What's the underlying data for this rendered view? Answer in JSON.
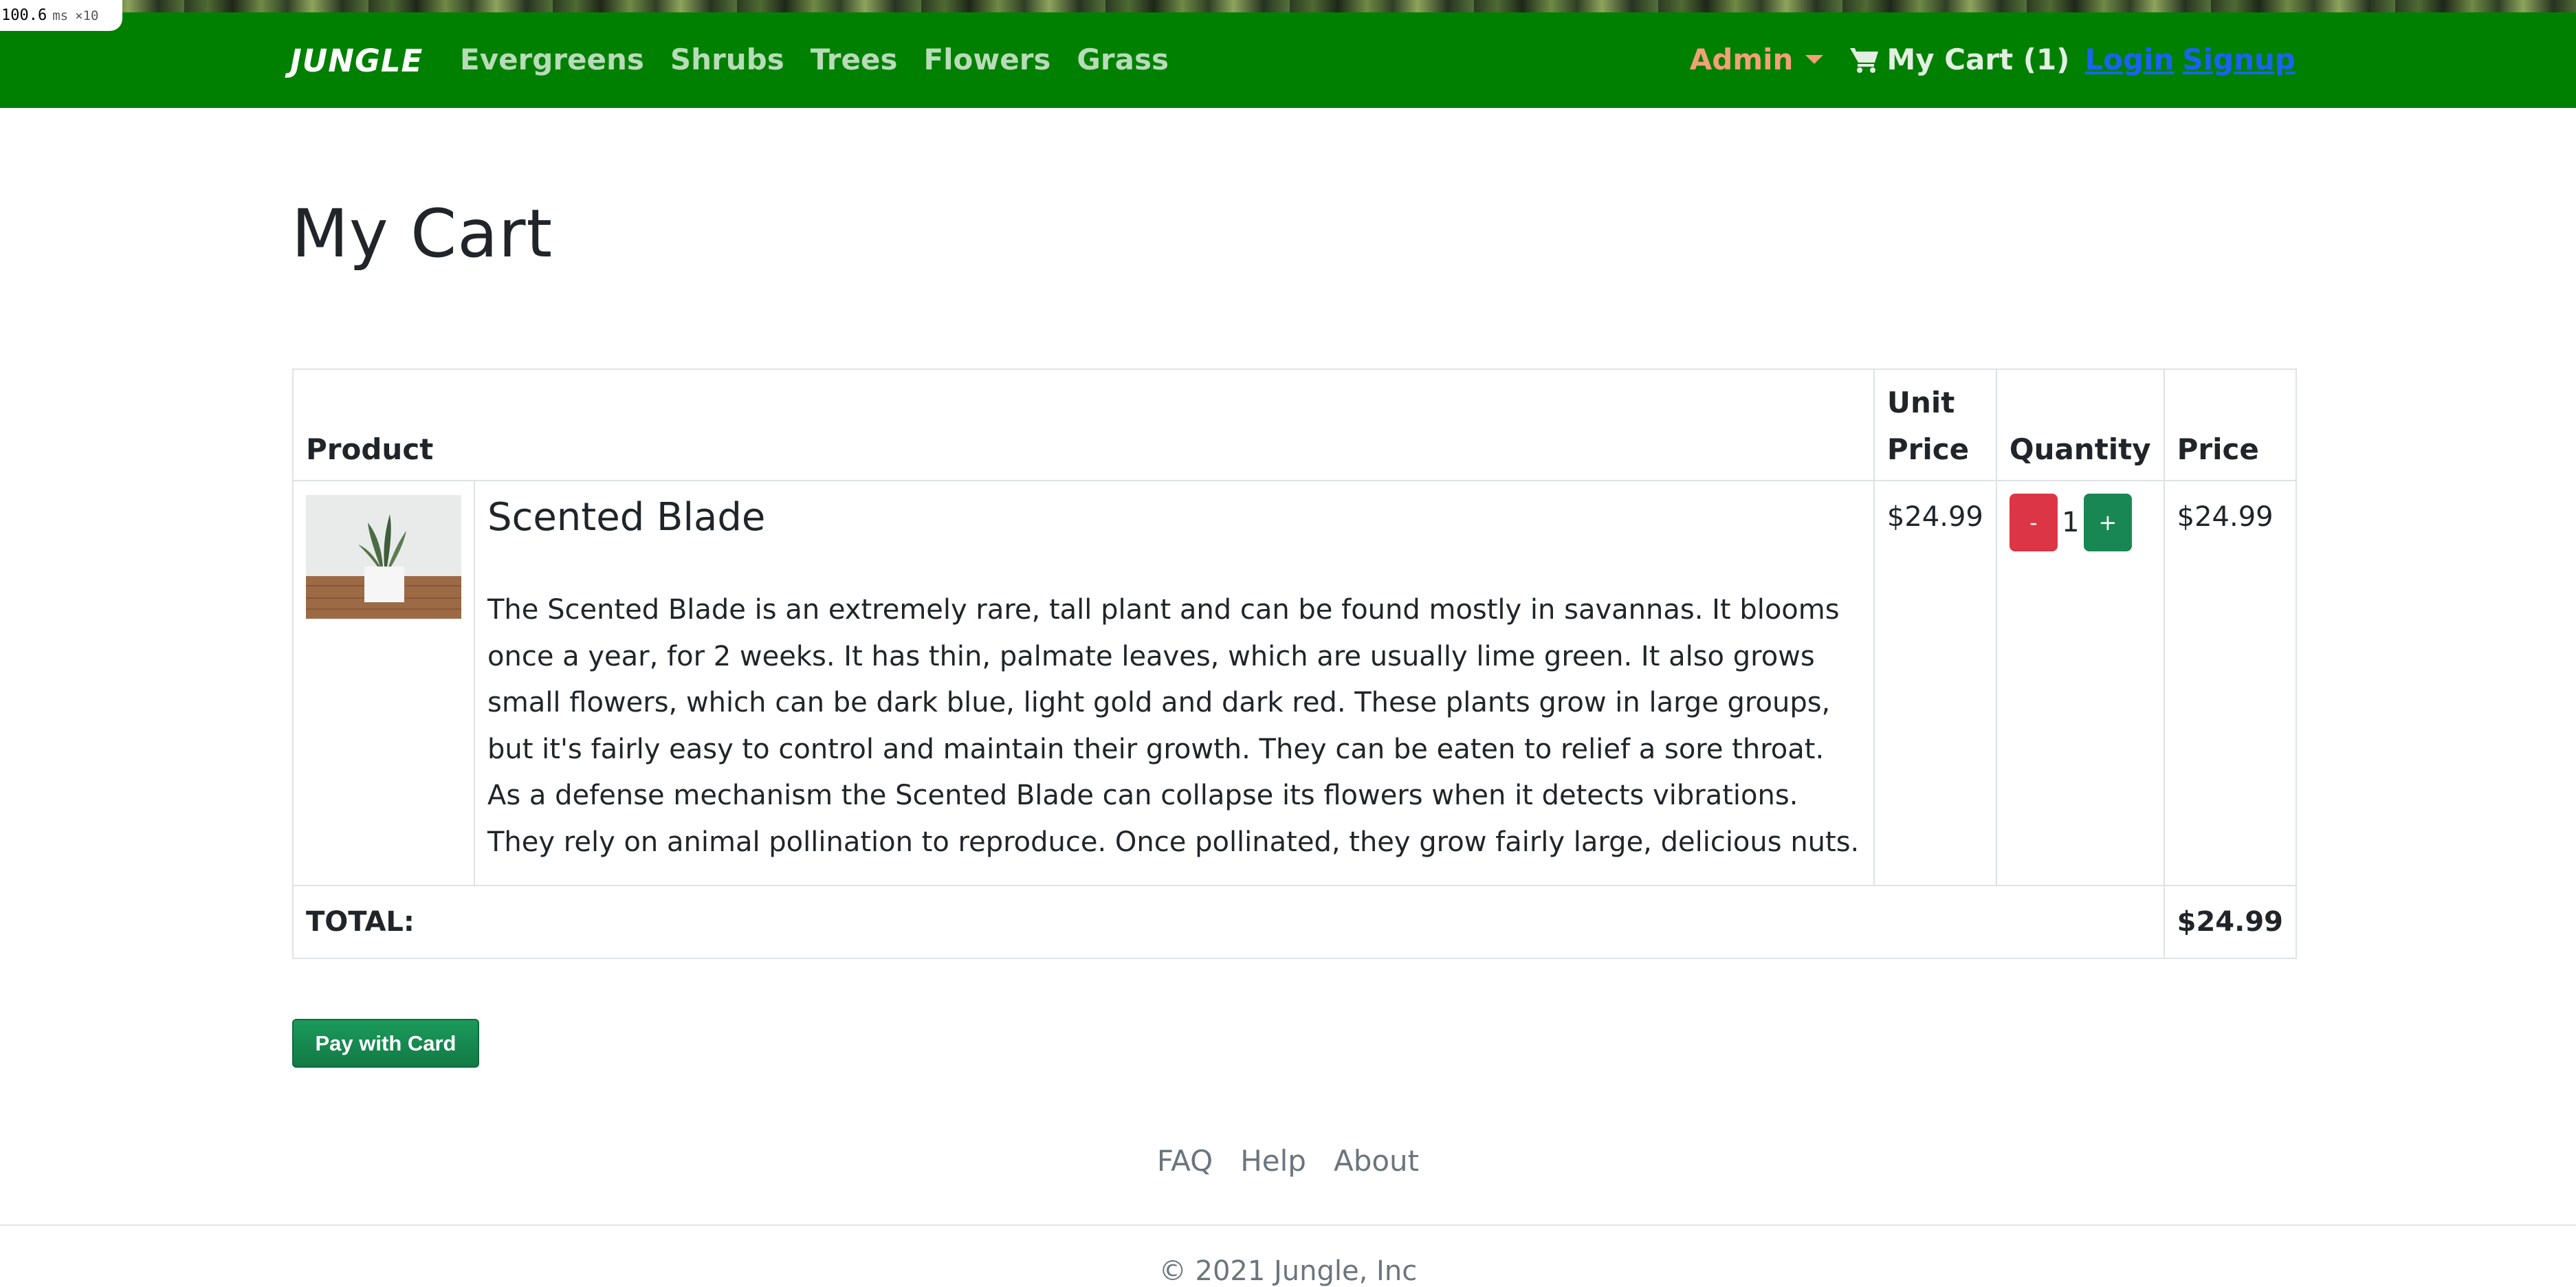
{
  "perf": {
    "value": "100.6",
    "unit": "ms",
    "multiplier": "×10"
  },
  "navbar": {
    "brand": "JUNGLE",
    "links": [
      "Evergreens",
      "Shrubs",
      "Trees",
      "Flowers",
      "Grass"
    ],
    "admin_label": "Admin",
    "cart_label": "My Cart (1)",
    "login_label": "Login",
    "signup_label": "Signup"
  },
  "page": {
    "title": "My Cart"
  },
  "cart_table": {
    "headers": {
      "product": "Product",
      "unit_price": "Unit Price",
      "quantity": "Quantity",
      "price": "Price"
    },
    "items": [
      {
        "name": "Scented Blade",
        "description": "The Scented Blade is an extremely rare, tall plant and can be found mostly in savannas. It blooms once a year, for 2 weeks. It has thin, palmate leaves, which are usually lime green. It also grows small flowers, which can be dark blue, light gold and dark red. These plants grow in large groups, but it's fairly easy to control and maintain their growth. They can be eaten to relief a sore throat. As a defense mechanism the Scented Blade can collapse its flowers when it detects vibrations. They rely on animal pollination to reproduce. Once pollinated, they grow fairly large, delicious nuts.",
        "unit_price": "$24.99",
        "quantity": "1",
        "price": "$24.99",
        "minus_label": "-",
        "plus_label": "+"
      }
    ],
    "total_label": "TOTAL:",
    "total_value": "$24.99"
  },
  "pay_button_label": "Pay with Card",
  "footer": {
    "links": [
      "FAQ",
      "Help",
      "About"
    ],
    "copyright": "© 2021 Jungle, Inc"
  },
  "colors": {
    "navbar_bg": "#008000",
    "admin": "#f2a077",
    "auth_link": "#1a63f0",
    "minus_button": "#dc3545",
    "plus_button": "#198754",
    "pay_button": "#198754"
  },
  "icons": [
    "caret-down-icon",
    "shopping-cart-icon"
  ]
}
